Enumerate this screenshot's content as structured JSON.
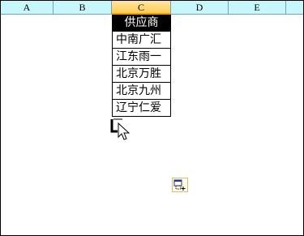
{
  "columns": [
    {
      "label": "A",
      "selected": false
    },
    {
      "label": "B",
      "selected": false
    },
    {
      "label": "C",
      "selected": true
    },
    {
      "label": "D",
      "selected": false
    },
    {
      "label": "E",
      "selected": false
    }
  ],
  "cells": {
    "header": "供应商",
    "rows": [
      "中南广汇",
      "江东雨一",
      "北京万胜",
      "北京九州",
      "辽宁仁爱"
    ]
  },
  "icons": {
    "cursor": "arrow-cursor-icon",
    "drag": "fill-handle-icon",
    "paste": "paste-options-icon"
  },
  "colors": {
    "header_bg": "#c6f7fb",
    "selected_col": "#ffcc55",
    "table_header_bg": "#000000",
    "table_header_fg": "#ffffff"
  }
}
